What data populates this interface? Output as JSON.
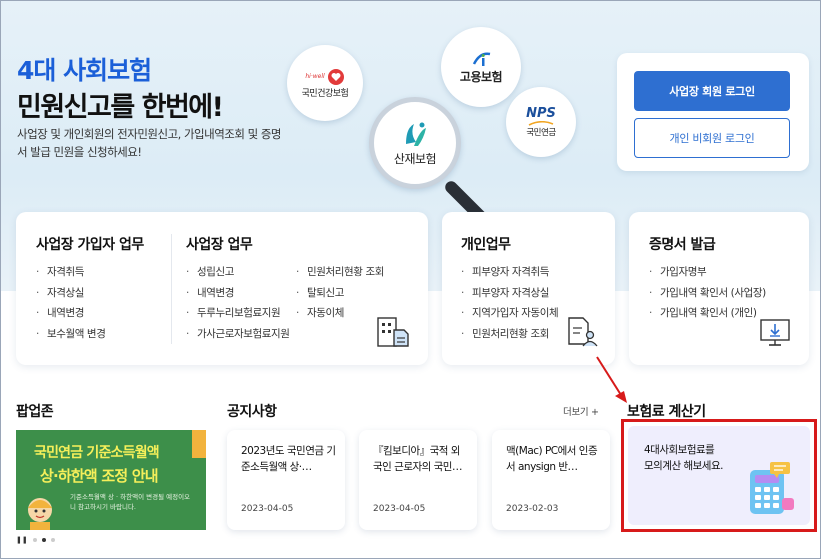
{
  "hero": {
    "title_line1": "4대 사회보험",
    "title_line2": "민원신고를 한번에!",
    "description": "사업장 및 개인회원의 전자민원신고, 가입내역조회 및 증명서 발급 민원을 신청하세요!",
    "agencies": {
      "nhis": "국민건강보험",
      "nhis_tag": "hi·well",
      "ei": "고용보험",
      "nps": "국민연금",
      "nps_logo": "NPS",
      "kcomwel": "산재보험"
    }
  },
  "login": {
    "business_member_label": "사업장 회원 로그인",
    "individual_nonmember_label": "개인 비회원 로그인"
  },
  "cards": {
    "business_subscriber": {
      "title": "사업장 가입자 업무",
      "items": [
        "자격취득",
        "자격상실",
        "내역변경",
        "보수월액 변경"
      ]
    },
    "business": {
      "title": "사업장 업무",
      "items_col1": [
        "성립신고",
        "내역변경",
        "두루누리보험료지원",
        "가사근로자보험료지원"
      ],
      "items_col2": [
        "민원처리현황 조회",
        "탈퇴신고",
        "자동이체"
      ]
    },
    "individual": {
      "title": "개인업무",
      "items": [
        "피부양자 자격취득",
        "피부양자 자격상실",
        "지역가입자 자동이체",
        "민원처리현황 조회"
      ]
    },
    "certificate": {
      "title": "증명서 발급",
      "items": [
        "가입자명부",
        "가입내역 확인서 (사업장)",
        "가입내역 확인서 (개인)"
      ]
    }
  },
  "popup_zone": {
    "title": "팝업존",
    "banner_line1": "국민연금 기준소득월액",
    "banner_line2": "상·하한액 조정 안내",
    "banner_sub": "기준소득월액 상 · 하한액이 변경될 예정이오니 참고하시기 바랍니다."
  },
  "notices": {
    "title": "공지사항",
    "more_label": "더보기 +",
    "items": [
      {
        "text": "2023년도 국민연금 기준소득월액 상·…",
        "date": "2023-04-05"
      },
      {
        "text": "『킴보디아』국적 외국인 근로자의 국민…",
        "date": "2023-04-05"
      },
      {
        "text": "맥(Mac) PC에서 인증서 anysign 반…",
        "date": "2023-02-03"
      }
    ]
  },
  "calculator": {
    "title": "보험료 계산기",
    "text_line1": "4대사회보험료를",
    "text_line2": "모의계산 해보세요."
  },
  "colors": {
    "accent_blue": "#2e6fd1",
    "highlight_red": "#d71a1a",
    "banner_green": "#3d8f4a"
  }
}
